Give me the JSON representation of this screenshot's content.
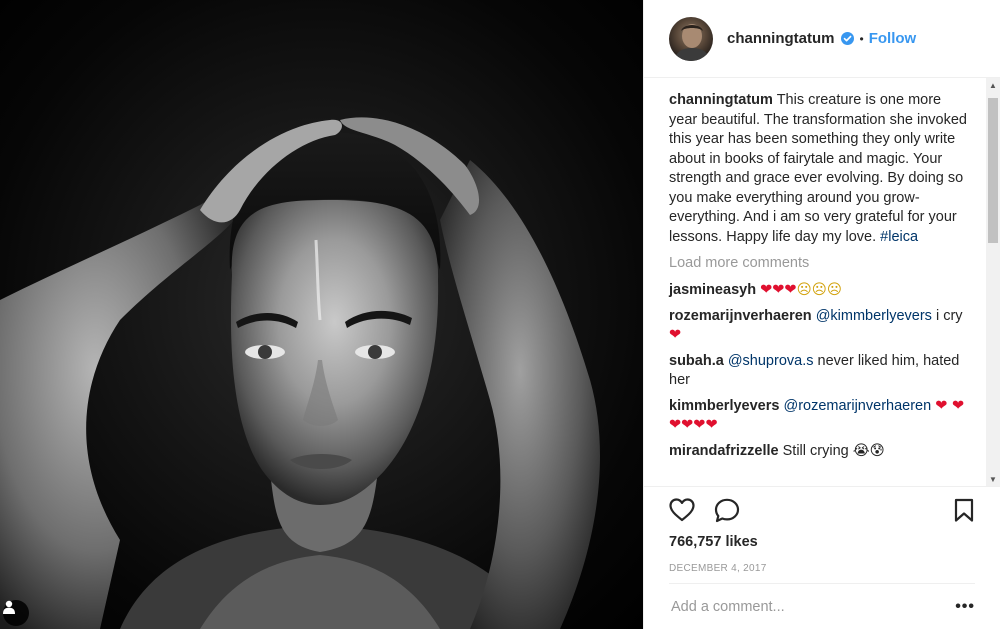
{
  "post": {
    "author": "channingtatum",
    "follow_label": "Follow",
    "dot": "•",
    "caption": {
      "user": "channingtatum",
      "text": "This creature is one more year beautiful. The transformation she invoked this year has been something they only write about in books of fairytale and magic. Your strength and grace ever evolving. By doing so you make everything around you grow- everything. And i am so very grateful for your lessons. Happy life day my love.",
      "hashtag": "#leica"
    },
    "load_more_label": "Load more comments",
    "comments": [
      {
        "user": "jasmineasyh",
        "emoji": "❤❤❤☹☹☹"
      },
      {
        "user": "rozemarijnverhaeren",
        "mention": "@kimmberlyevers",
        "text": "i cry",
        "emoji": "❤"
      },
      {
        "user": "subah.a",
        "mention": "@shuprova.s",
        "text": "never liked him, hated her"
      },
      {
        "user": "kimmberlyevers",
        "mention": "@rozemarijnverhaeren",
        "emoji": "❤ ❤❤❤❤❤"
      },
      {
        "user": "mirandafrizzelle",
        "text": "Still crying",
        "emoji": "😭😰"
      }
    ],
    "likes": "766,757 likes",
    "date": "DECEMBER 4, 2017",
    "add_comment_placeholder": "Add a comment...",
    "more_options": "•••"
  },
  "icons": [
    "user-tag-icon",
    "verified-badge-icon",
    "heart-icon",
    "comment-icon",
    "bookmark-icon",
    "more-options-icon"
  ],
  "colors": {
    "link": "#3897f0",
    "mention": "#003569",
    "muted": "#999999",
    "heart": "#e0102f"
  }
}
